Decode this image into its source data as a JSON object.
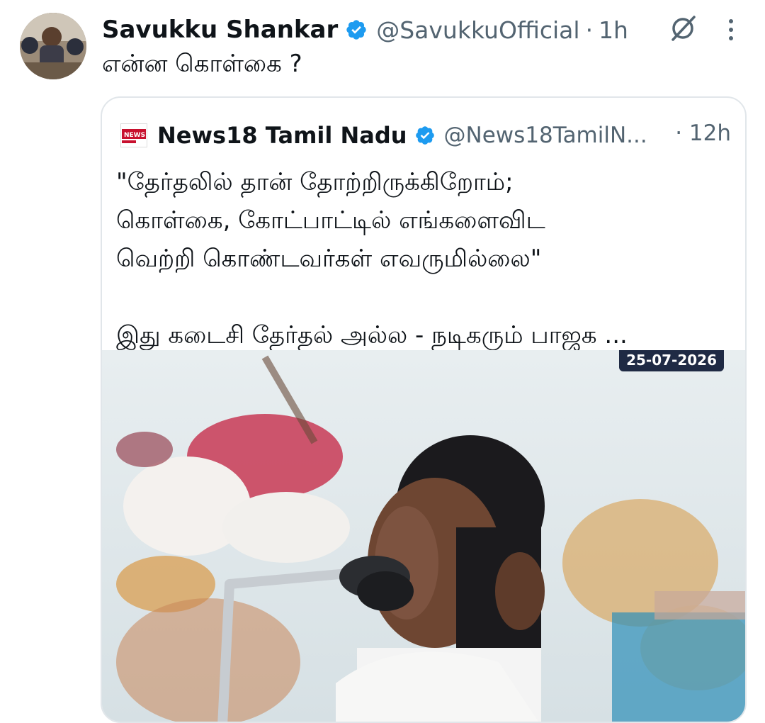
{
  "post": {
    "author_name": "Savukku Shankar",
    "handle": "@SavukkuOfficial",
    "separator": "·",
    "time": "1h",
    "text": "என்ன கொள்கை ?",
    "verified": true
  },
  "quoted": {
    "author_name": "News18 Tamil Nadu",
    "handle": "@News18TamilN...",
    "separator": "·",
    "time": "12h",
    "logo_text": "NEWS18",
    "lines": [
      "\"தேர்தலில் தான் தோற்றிருக்கிறோம்;",
      "கொள்கை, கோட்பாட்டில் எங்களைவிட",
      "வெற்றி கொண்டவர்கள் எவருமில்லை\""
    ],
    "last_line": "இது கடைசி தேர்தல் அல்ல - நடிகரும் பாஜக ...",
    "media": {
      "date_badge": "25-07-2026"
    }
  },
  "colors": {
    "verified_blue": "#1d9bf0",
    "secondary_text": "#536471",
    "primary_text": "#0f1419"
  },
  "icons": [
    "verified-icon",
    "grok-icon",
    "more-icon"
  ]
}
